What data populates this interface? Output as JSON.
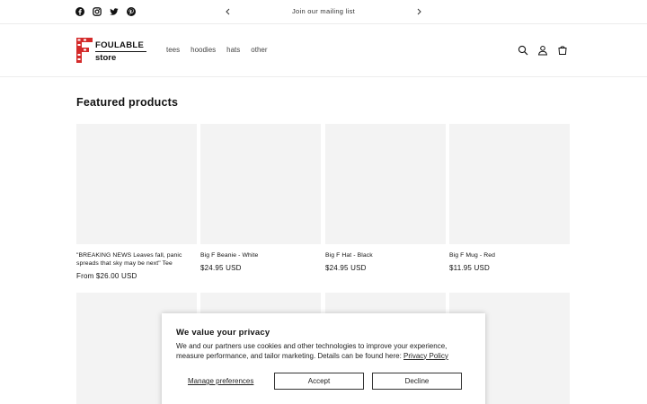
{
  "announcement": {
    "text": "Join our mailing list",
    "social_icons": [
      "facebook-icon",
      "instagram-icon",
      "twitter-icon",
      "pinterest-icon"
    ]
  },
  "header": {
    "logo_line1": "FOULABLE",
    "logo_line2": "store",
    "nav": [
      "tees",
      "hoodies",
      "hats",
      "other"
    ],
    "icons": [
      "search-icon",
      "account-icon",
      "cart-icon"
    ]
  },
  "main": {
    "section_title": "Featured products",
    "products": [
      {
        "title": "\"BREAKING NEWS Leaves fall, panic spreads that sky may be next\" Tee",
        "price": "From $26.00 USD"
      },
      {
        "title": "Big F Beanie - White",
        "price": "$24.95 USD"
      },
      {
        "title": "Big F Hat - Black",
        "price": "$24.95 USD"
      },
      {
        "title": "Big F Mug - Red",
        "price": "$11.95 USD"
      }
    ]
  },
  "consent": {
    "title": "We value your privacy",
    "body": "We and our partners use cookies and other technologies to improve your experience, measure performance, and tailor marketing. Details can be found here:",
    "link": "Privacy Policy",
    "manage": "Manage preferences",
    "accept": "Accept",
    "decline": "Decline"
  },
  "colors": {
    "text": "#121212",
    "placeholder": "#f3f3f3",
    "logo_red": "#d42a2a"
  }
}
